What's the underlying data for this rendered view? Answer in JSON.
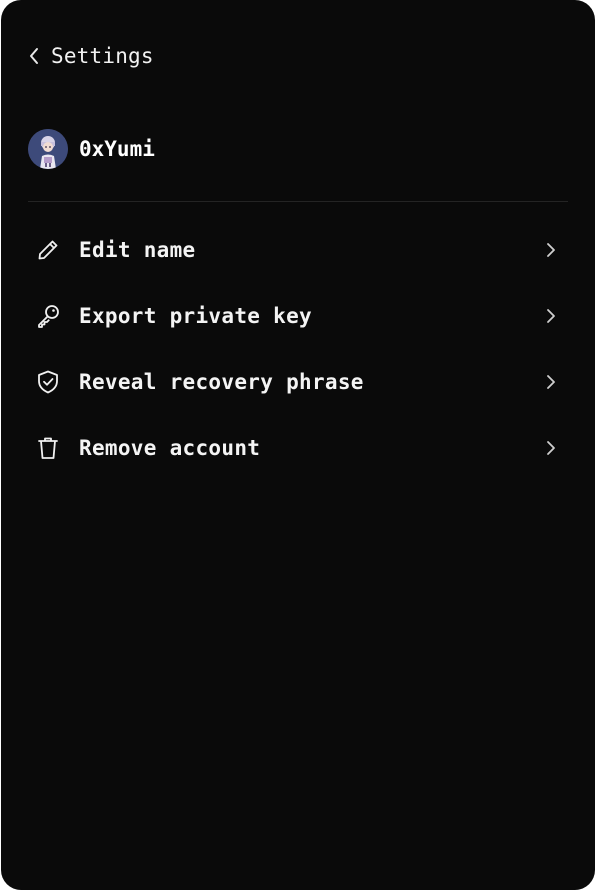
{
  "header": {
    "title": "Settings",
    "back_icon": "chevron-left-icon"
  },
  "account": {
    "name": "0xYumi",
    "avatar_icon": "avatar"
  },
  "menu": {
    "items": [
      {
        "label": "Edit name",
        "icon": "pencil-icon"
      },
      {
        "label": "Export private key",
        "icon": "key-icon"
      },
      {
        "label": "Reveal recovery phrase",
        "icon": "shield-check-icon"
      },
      {
        "label": "Remove account",
        "icon": "trash-icon"
      }
    ]
  },
  "colors": {
    "background": "#0a0a0a",
    "text": "#ffffff",
    "divider": "#242424",
    "muted": "#bdbdbd"
  }
}
